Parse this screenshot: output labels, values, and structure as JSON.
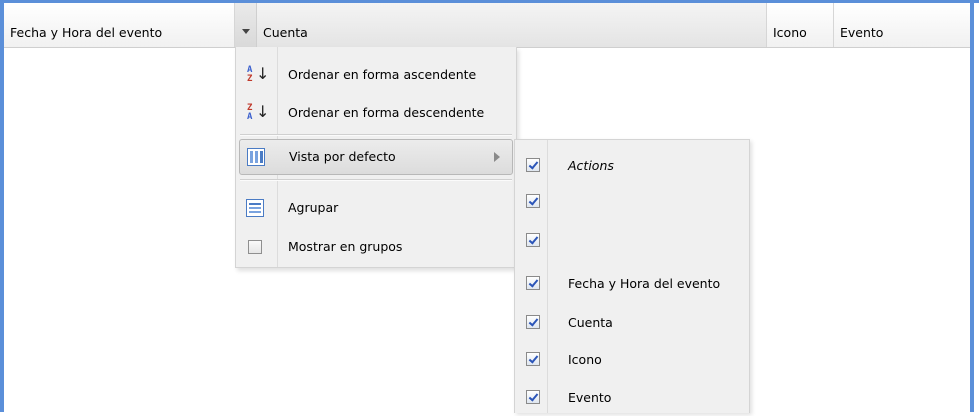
{
  "header": {
    "columns": {
      "fecha": "Fecha y Hora del evento",
      "cuenta": "Cuenta",
      "icono": "Icono",
      "evento": "Evento"
    }
  },
  "column_menu": {
    "sort_asc": "Ordenar en forma ascendente",
    "sort_desc": "Ordenar en forma descendente",
    "default_view": "Vista por defecto",
    "group": "Agrupar",
    "show_in_groups": "Mostrar en grupos",
    "sort_asc_icon_letters": [
      "A",
      "Z"
    ],
    "sort_desc_icon_letters": [
      "Z",
      "A"
    ],
    "icons": [
      "sort-ascending-icon",
      "sort-descending-icon",
      "columns-icon",
      "group-icon",
      "checkbox-icon"
    ]
  },
  "columns_submenu": {
    "items": [
      {
        "label": "Actions",
        "checked": true
      },
      {
        "label": "",
        "checked": true
      },
      {
        "label": "",
        "checked": true
      },
      {
        "label": "Fecha y Hora del evento",
        "checked": true
      },
      {
        "label": "Cuenta",
        "checked": true
      },
      {
        "label": "Icono",
        "checked": true
      },
      {
        "label": "Evento",
        "checked": true
      }
    ]
  },
  "colors": {
    "frame": "#5b8fd9",
    "menu_bg": "#f0f0f0",
    "check": "#2b55b8"
  }
}
